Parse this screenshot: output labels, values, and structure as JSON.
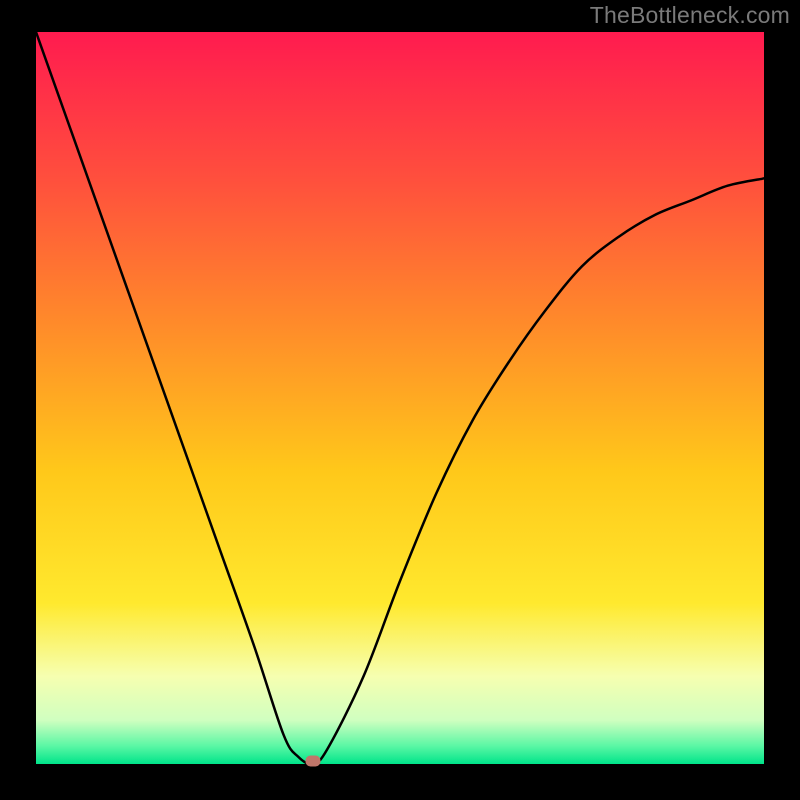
{
  "watermark": "TheBottleneck.com",
  "chart_data": {
    "type": "line",
    "title": "",
    "xlabel": "",
    "ylabel": "",
    "xlim": [
      0,
      1
    ],
    "ylim": [
      0,
      1
    ],
    "series": [
      {
        "name": "bottleneck-curve",
        "x": [
          0.0,
          0.05,
          0.1,
          0.15,
          0.2,
          0.25,
          0.3,
          0.34,
          0.36,
          0.38,
          0.4,
          0.45,
          0.5,
          0.55,
          0.6,
          0.65,
          0.7,
          0.75,
          0.8,
          0.85,
          0.9,
          0.95,
          1.0
        ],
        "y": [
          1.0,
          0.86,
          0.72,
          0.58,
          0.44,
          0.3,
          0.16,
          0.04,
          0.01,
          0.0,
          0.02,
          0.12,
          0.25,
          0.37,
          0.47,
          0.55,
          0.62,
          0.68,
          0.72,
          0.75,
          0.77,
          0.79,
          0.8
        ]
      }
    ],
    "marker": {
      "x": 0.38,
      "y": 0.0
    },
    "gradient_stops": [
      {
        "offset": 0.0,
        "color": "#ff1b4f"
      },
      {
        "offset": 0.2,
        "color": "#ff4f3d"
      },
      {
        "offset": 0.4,
        "color": "#ff8b2a"
      },
      {
        "offset": 0.6,
        "color": "#ffc81a"
      },
      {
        "offset": 0.78,
        "color": "#ffe92e"
      },
      {
        "offset": 0.88,
        "color": "#f6ffb0"
      },
      {
        "offset": 0.94,
        "color": "#d0ffc0"
      },
      {
        "offset": 0.975,
        "color": "#5cf7a5"
      },
      {
        "offset": 1.0,
        "color": "#00e48a"
      }
    ]
  }
}
